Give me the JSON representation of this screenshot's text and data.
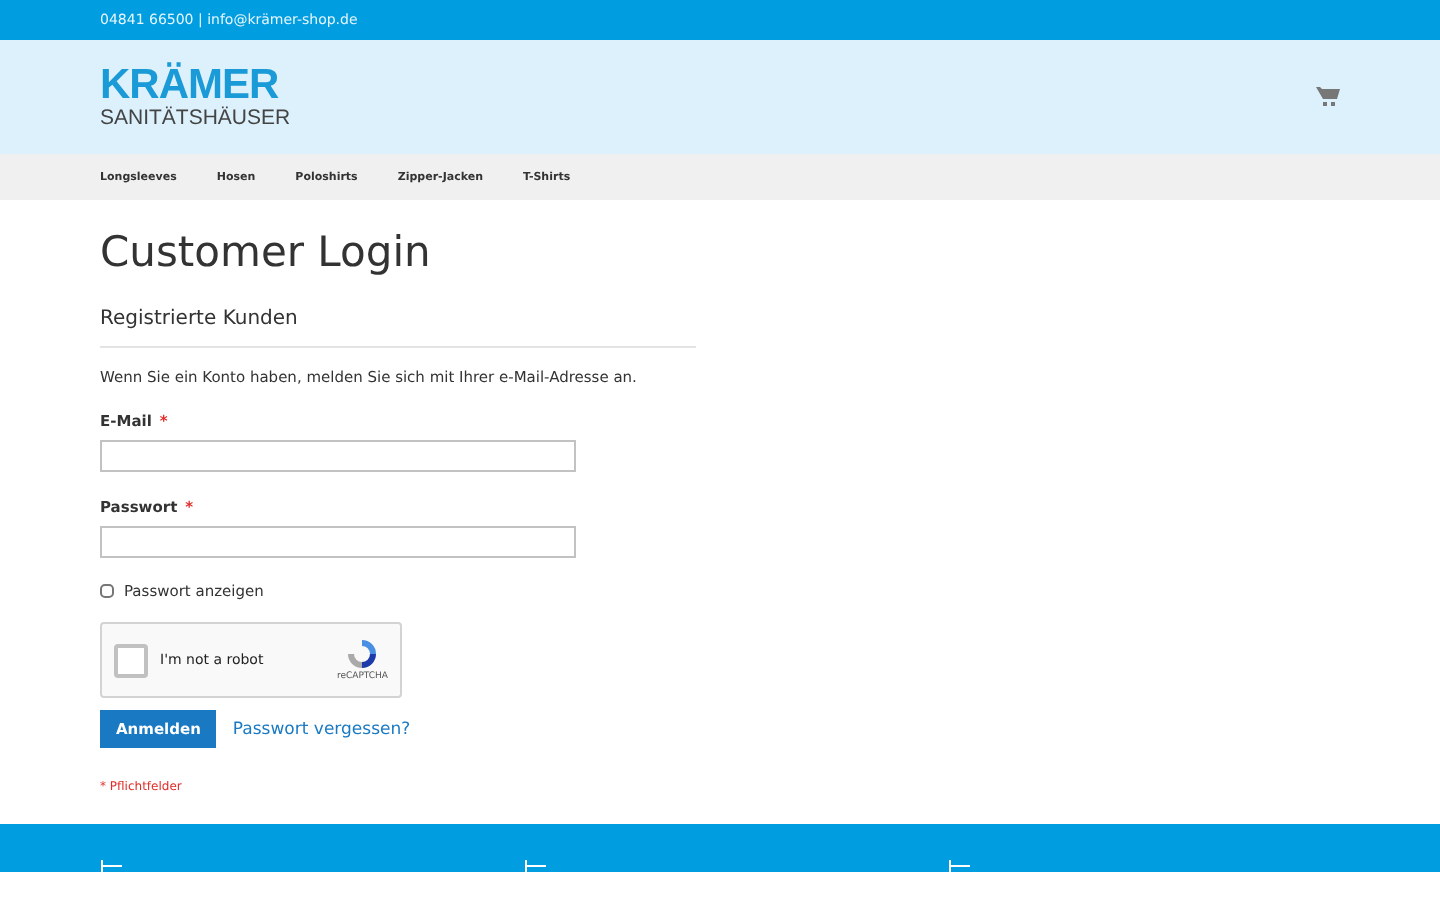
{
  "top_bar": {
    "contact": "04841 66500 | info@krämer-shop.de"
  },
  "logo": {
    "name": "KRÄMER",
    "subtitle": "SANITÄTSHÄUSER"
  },
  "nav": {
    "items": [
      {
        "label": "Longsleeves"
      },
      {
        "label": "Hosen"
      },
      {
        "label": "Poloshirts"
      },
      {
        "label": "Zipper-Jacken"
      },
      {
        "label": "T-Shirts"
      }
    ]
  },
  "page_title": "Customer Login",
  "login": {
    "heading": "Registrierte Kunden",
    "intro": "Wenn Sie ein Konto haben, melden Sie sich mit Ihrer e-Mail-Adresse an.",
    "fields": [
      {
        "label": "E-Mail",
        "required_mark": "*"
      },
      {
        "label": "Passwort",
        "required_mark": "*"
      }
    ],
    "show_password": {
      "label": "Passwort anzeigen",
      "checked": false
    },
    "captcha": {
      "label": "I'm not a robot",
      "brand": "reCAPTCHA",
      "checked": false
    },
    "submit": "Anmelden",
    "forgot_link": "Passwort vergessen?",
    "required_note": "* Pflichtfelder"
  }
}
